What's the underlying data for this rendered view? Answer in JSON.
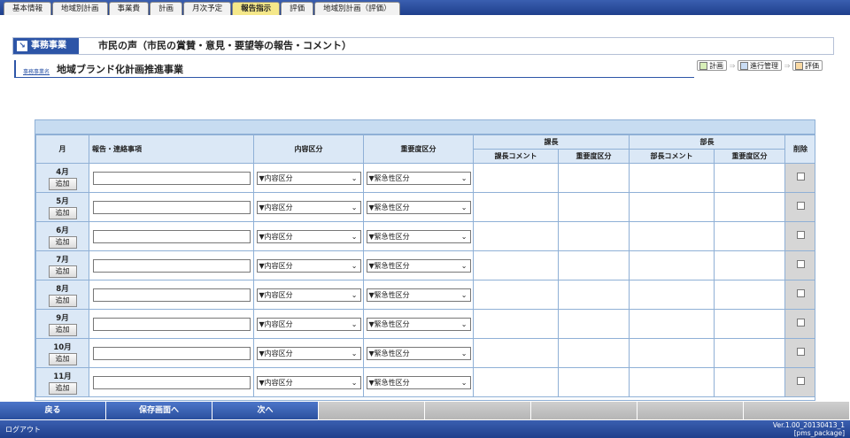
{
  "tabs": [
    {
      "label": "基本情報",
      "active": false
    },
    {
      "label": "地域別計画",
      "active": false
    },
    {
      "label": "事業費",
      "active": false
    },
    {
      "label": "計画",
      "active": false
    },
    {
      "label": "月次予定",
      "active": false
    },
    {
      "label": "報告指示",
      "active": true
    },
    {
      "label": "評価",
      "active": false
    },
    {
      "label": "地域別計画（評価）",
      "active": false
    }
  ],
  "header": {
    "tag": "事務事業",
    "title": "市民の声（市民の賞賛・意見・要望等の報告・コメント）",
    "project_label": "事務事業名",
    "project_name": "地域ブランド化計画推進事業"
  },
  "flow": [
    {
      "label": "計画",
      "color": "#d8efb8"
    },
    {
      "label": "進行管理",
      "color": "#c9dcf4"
    },
    {
      "label": "評価",
      "color": "#f9d9a3"
    }
  ],
  "table": {
    "headers": {
      "month": "月",
      "report": "報告・連絡事項",
      "content": "内容区分",
      "importance": "重要度区分",
      "section_chief": "課長",
      "chief_comment": "課長コメント",
      "chief_importance": "重要度区分",
      "dept_head": "部長",
      "head_comment": "部長コメント",
      "head_importance": "重要度区分",
      "delete": "削除"
    },
    "add_label": "追加",
    "rows": [
      {
        "month": "4月",
        "report": "",
        "content": "▼内容区分",
        "importance": "▼緊急性区分"
      },
      {
        "month": "5月",
        "report": "",
        "content": "▼内容区分",
        "importance": "▼緊急性区分"
      },
      {
        "month": "6月",
        "report": "",
        "content": "▼内容区分",
        "importance": "▼緊急性区分"
      },
      {
        "month": "7月",
        "report": "",
        "content": "▼内容区分",
        "importance": "▼緊急性区分"
      },
      {
        "month": "8月",
        "report": "",
        "content": "▼内容区分",
        "importance": "▼緊急性区分"
      },
      {
        "month": "9月",
        "report": "",
        "content": "▼内容区分",
        "importance": "▼緊急性区分"
      },
      {
        "month": "10月",
        "report": "",
        "content": "▼内容区分",
        "importance": "▼緊急性区分"
      },
      {
        "month": "11月",
        "report": "",
        "content": "▼内容区分",
        "importance": "▼緊急性区分"
      }
    ]
  },
  "footer": {
    "buttons": [
      "戻る",
      "保存画面へ",
      "次へ",
      "",
      "",
      "",
      "",
      ""
    ],
    "logout": "ログアウト",
    "version_line1": "Ver.1.00_20130413_1",
    "version_line2": "[pms_package]"
  }
}
